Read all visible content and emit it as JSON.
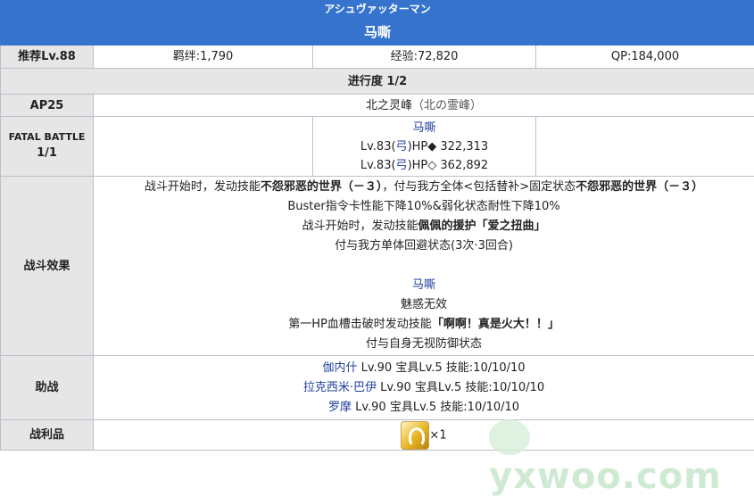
{
  "header": {
    "subtitle": "アシュヴァッターマン",
    "title": "马嘶"
  },
  "stats": {
    "level": "推荐Lv.88",
    "bond": "羁绊:1,790",
    "exp": "经验:72,820",
    "qp": "QP:184,000"
  },
  "progress": "进行度 1/2",
  "ap": {
    "label": "AP25",
    "location": "北之灵峰",
    "location_jp": "（北の霊峰）"
  },
  "fatal": {
    "label": "FATAL BATTLE",
    "count": "1/1",
    "enemy_name": "马嘶",
    "line1_prefix": "Lv.83(",
    "line1_class": "弓",
    "line1_suffix": ")HP◆ 322,313",
    "line2_prefix": "Lv.83(",
    "line2_class": "弓",
    "line2_suffix": ")HP◇ 362,892"
  },
  "effects": {
    "label": "战斗效果",
    "l1_a": "战斗开始时，发动技能",
    "l1_b": "不怨邪恶的世界（－３）",
    "l1_c": "，付与我方全体<包括替补>固定状态",
    "l1_d": "不怨邪恶的世界（－３）",
    "l2": "Buster指令卡性能下降10%&弱化状态耐性下降10%",
    "l3_a": "战斗开始时，发动技能",
    "l3_b": "佩佩的援护「爱之扭曲」",
    "l4": "付与我方单体回避状态(3次·3回合)",
    "enemy": "马嘶",
    "l5": "魅惑无效",
    "l6_a": "第一HP血槽击破时发动技能",
    "l6_b": "「啊啊！真是火大！！」",
    "l7": "付与自身无视防御状态"
  },
  "support": {
    "label": "助战",
    "rows": [
      {
        "name": "伽内什",
        "info": " Lv.90 宝具Lv.5 技能:10/10/10"
      },
      {
        "name": "拉克西米·巴伊",
        "info": " Lv.90 宝具Lv.5 技能:10/10/10"
      },
      {
        "name": "罗摩",
        "info": " Lv.90 宝具Lv.5 技能:10/10/10"
      }
    ]
  },
  "drops": {
    "label": "战利品",
    "count": "×1",
    "icon": "golden-gem-icon"
  },
  "watermark": "yxwoo.com"
}
